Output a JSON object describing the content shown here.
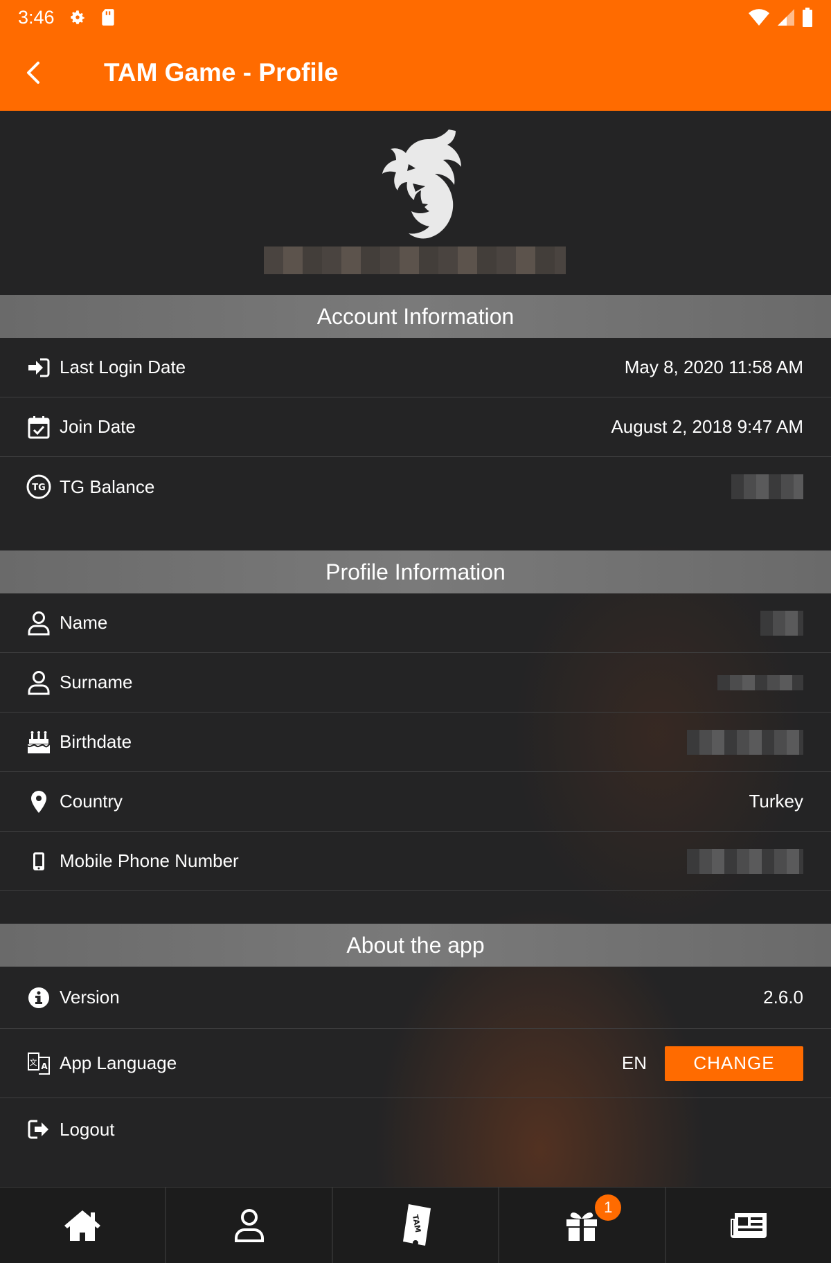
{
  "status_bar": {
    "time": "3:46"
  },
  "app_bar": {
    "title": "TAM Game - Profile"
  },
  "account_section": {
    "header": "Account Information",
    "rows": [
      {
        "label": "Last Login Date",
        "value": "May 8, 2020 11:58 AM",
        "icon": "login-icon"
      },
      {
        "label": "Join Date",
        "value": "August 2, 2018 9:47 AM",
        "icon": "calendar-check-icon"
      },
      {
        "label": "TG Balance",
        "value": "",
        "icon": "tg-coin-icon"
      }
    ]
  },
  "profile_section": {
    "header": "Profile Information",
    "rows": [
      {
        "label": "Name",
        "value": "",
        "icon": "user-icon"
      },
      {
        "label": "Surname",
        "value": "",
        "icon": "user-icon"
      },
      {
        "label": "Birthdate",
        "value": "",
        "icon": "birthday-cake-icon"
      },
      {
        "label": "Country",
        "value": "Turkey",
        "icon": "map-marker-icon"
      },
      {
        "label": "Mobile Phone Number",
        "value": "",
        "icon": "mobile-phone-icon"
      }
    ]
  },
  "about_section": {
    "header": "About the app",
    "version": {
      "label": "Version",
      "value": "2.6.0",
      "icon": "info-icon"
    },
    "language": {
      "label": "App Language",
      "value": "EN",
      "button": "CHANGE",
      "icon": "translate-icon"
    },
    "logout": {
      "label": "Logout",
      "icon": "logout-icon"
    }
  },
  "bottom_nav": {
    "tabs": [
      "home-icon",
      "profile-icon",
      "tam-ticket-icon",
      "gift-icon",
      "news-icon"
    ],
    "gift_badge": "1"
  },
  "colors": {
    "accent": "#ff6b00",
    "background": "#242425",
    "section_header": "#707070"
  }
}
